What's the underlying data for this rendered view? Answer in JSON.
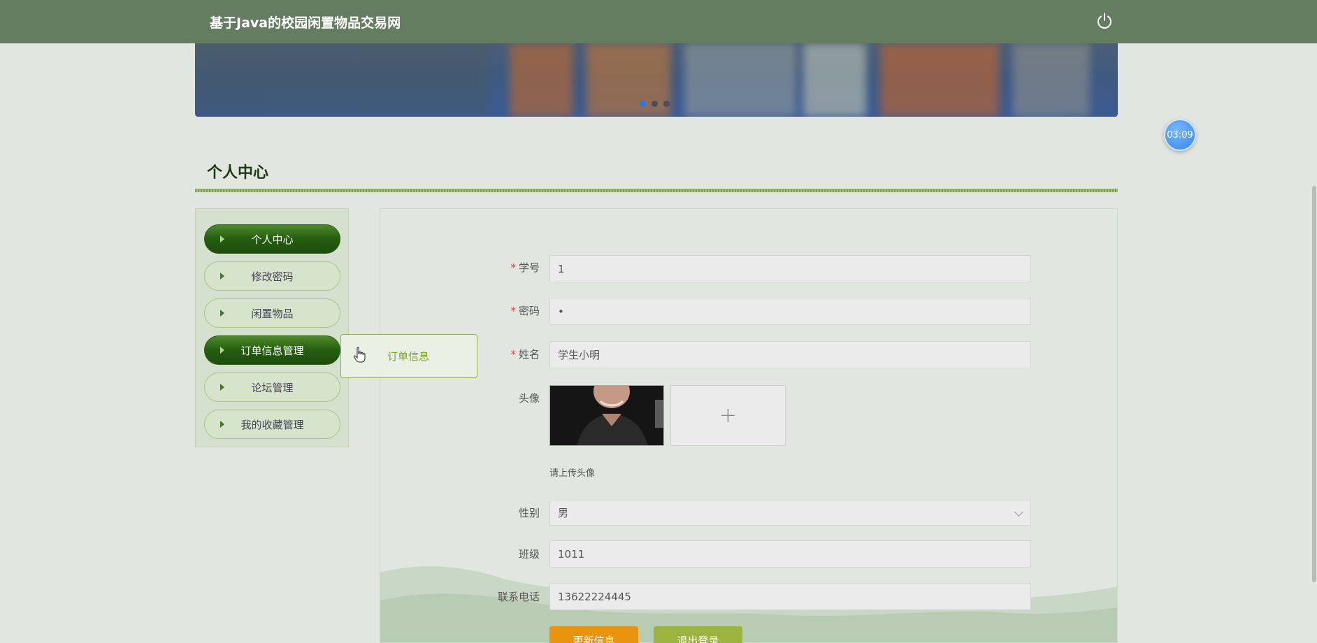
{
  "header": {
    "title": "基于Java的校园闲置物品交易网"
  },
  "banner": {
    "slides": 3,
    "active_slide": 0
  },
  "timer": {
    "text": "03:09"
  },
  "section": {
    "title": "个人中心"
  },
  "sidebar": {
    "items": [
      {
        "label": "个人中心",
        "active": true
      },
      {
        "label": "修改密码",
        "active": false
      },
      {
        "label": "闲置物品",
        "active": false
      },
      {
        "label": "订单信息管理",
        "active": true
      },
      {
        "label": "论坛管理",
        "active": false
      },
      {
        "label": "我的收藏管理",
        "active": false
      }
    ]
  },
  "submenu": {
    "items": [
      {
        "label": "订单信息"
      }
    ]
  },
  "form": {
    "student_id": {
      "label": "学号",
      "required": true,
      "value": "1"
    },
    "password": {
      "label": "密码",
      "required": true,
      "value": "•"
    },
    "name": {
      "label": "姓名",
      "required": true,
      "value": "学生小明"
    },
    "avatar": {
      "label": "头像",
      "upload_symbol": "+",
      "hint": "请上传头像"
    },
    "gender": {
      "label": "性别",
      "value": "男"
    },
    "class": {
      "label": "班级",
      "value": "1011"
    },
    "phone": {
      "label": "联系电话",
      "value": "13622224445"
    },
    "required_mark": "*"
  },
  "buttons": {
    "update": "更新信息",
    "logout": "退出登录"
  },
  "colors": {
    "header_bg": "#647c60",
    "page_bg": "#e1e6e1",
    "active_menu": "#245d10",
    "update_button": "#e8940f",
    "logout_button": "#9bb43f",
    "required": "#e0443a"
  },
  "icons": {
    "power": "power-icon",
    "menu_arrow": "caret-right-icon",
    "select": "chevron-down-icon",
    "cursor": "hand-pointer-icon"
  }
}
